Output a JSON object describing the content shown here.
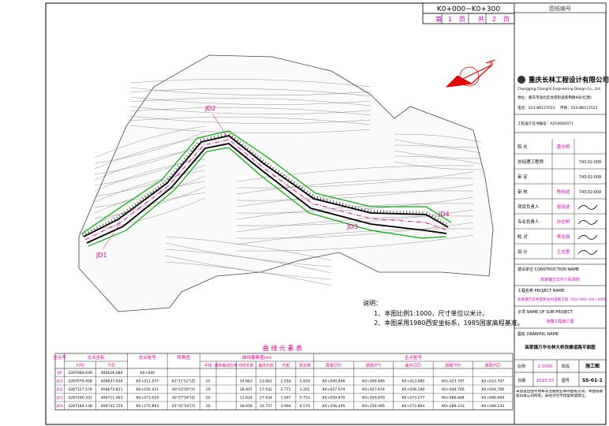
{
  "stake_range": "K0+000~K0+300",
  "sheet_no": {
    "prefix": "第",
    "page": "1",
    "unit1": "页",
    "total_prefix": "共",
    "total": "2",
    "unit2": "页"
  },
  "stamp_label": "图纸编号",
  "company": {
    "name_cn": "重庆长林工程设计有限公司",
    "name_en": "Chongqing Changlin Engineering Design Co., Ltd.",
    "address": "地址：重庆市渝北区龙塔街道紫荆路9号(红鼎)",
    "phone": "电话：023-88123523",
    "fax": "传真：023-88123523",
    "license": "工程设计证书编号：A250000371"
  },
  "title_rows": [
    {
      "label": "院 长",
      "name": "黄志明"
    },
    {
      "label": "总经理工程师",
      "name": ""
    },
    {
      "label": "审 定",
      "name": ""
    },
    {
      "label": "审 核",
      "name": "陈晓波"
    },
    {
      "label": "项目负责人",
      "name": "张晓波"
    },
    {
      "label": "专业负责人",
      "name": "孙志明"
    },
    {
      "label": "校 对",
      "name": "李志强"
    },
    {
      "label": "设 计",
      "name": "王志勇"
    }
  ],
  "cert_numbers": [
    "743-02-009",
    "743-02-009",
    "743-02-009"
  ],
  "construction_unit_label": "建设单位 CONSTRUCTION NAME",
  "construction_unit": "高家镇万华村人民政府",
  "project_label": "工程名称 PROJECT NAME",
  "project_name": "高家镇万华村至民主村道路工程（K0+000~K0+300）",
  "subproject_label": "子项 NAME OF SUB-PROJECT",
  "subproject": "道路工程施工图",
  "drawing_label": "图名 DRAWING NAME",
  "drawing_title": "高家镇万华长林大桥改建道路平面图",
  "footer": {
    "scale_label": "比例",
    "scale": "1:1000",
    "date_label": "日期",
    "date": "2015.07",
    "no_label": "图号",
    "no": "SS-01-1",
    "stage_label": "阶段",
    "stage": "施工图",
    "note": "未加盖出图专用章及注册执业章的图纸无效，本图纸版权归本公司所有，未经许可不得复制或转让。"
  },
  "notes": {
    "title": "说明：",
    "items": [
      "1、本图比例1:1000，尺寸单位以米计。",
      "2、本图采用1980西安坐标系，1985国家高程基准。"
    ]
  },
  "curve_table": {
    "title": "曲 线 元 素 表",
    "header1": [
      "交点号",
      "交点坐标",
      "交点桩号",
      "转角值",
      "曲线要素值(m)",
      "主点桩号"
    ],
    "header_coords": [
      "X(N)",
      "Y(E)"
    ],
    "header_elements": [
      "半径",
      "缓和曲线长度",
      "切线长度",
      "曲线长度",
      "外距",
      "校正值"
    ],
    "header_stakes": [
      "直缓(ZH)",
      "缓圆(HY)",
      "曲中(QZ)",
      "圆缓(YH)",
      "缓直(HZ)"
    ],
    "rows": [
      [
        "BP",
        "3287080.639",
        "406626.084",
        "K0+000",
        "",
        "",
        "",
        "",
        "",
        "",
        "",
        "",
        "",
        "",
        "",
        ""
      ],
      [
        "JD1",
        "3287079.458",
        "406637.634",
        "K0+011.577",
        "63°11'12\"(Z)",
        "25",
        "",
        "14.663",
        "23.662",
        "2.016",
        "5.659",
        "K0+000.846",
        "K0+000.846",
        "K0+013.085",
        "K0+023.707",
        "K0+023.707"
      ],
      [
        "JD2",
        "3287127.579",
        "406673.821",
        "K0+035.431",
        "40°43'50\"(Y)",
        "20",
        "",
        "18.407",
        "17.032",
        "2.771",
        "3.201",
        "K0+027.674",
        "K0+027.674",
        "K0+036.190",
        "K0+044.706",
        "K0+044.706"
      ],
      [
        "JD3",
        "3287160.331",
        "406711.463",
        "K0+073.024",
        "30°27'34\"(Z)",
        "50",
        "",
        "13.834",
        "27.634",
        "1.547",
        "0.753",
        "K0+059.870",
        "K0+059.870",
        "K0+073.277",
        "K0+086.694",
        "K0+086.694"
      ],
      [
        "JD4",
        "3287184.138",
        "406732.729",
        "K0+275.893",
        "61°31'54\"(Y)",
        "30",
        "",
        "18.658",
        "32.737",
        "3.944",
        "4.570",
        "K0+256.495",
        "K0+256.495",
        "K0+272.864",
        "K0+289.233",
        "K0+289.233"
      ]
    ]
  },
  "map_labels": {
    "jd1": "JD1",
    "jd2": "JD2",
    "jd3": "JD3",
    "jd4": "JD4"
  },
  "colors": {
    "road": "#000000",
    "centerline": "#e0008a",
    "boundary": "#00b000",
    "contour": "#555555",
    "north": "#e00000",
    "accent": "#d000c0"
  }
}
